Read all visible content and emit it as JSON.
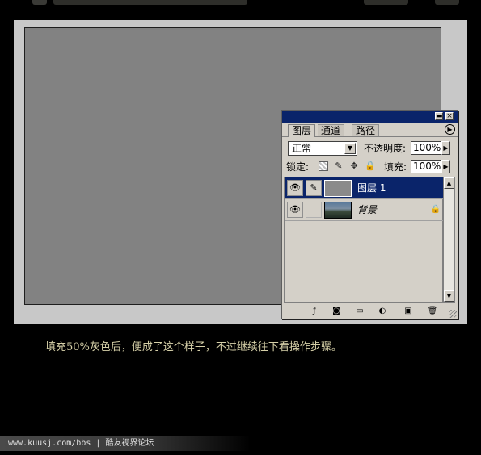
{
  "panel": {
    "tabs": [
      "图层",
      "通道",
      "路径"
    ],
    "blend_mode": "正常",
    "opacity_label": "不透明度:",
    "opacity_value": "100%",
    "lock_label": "锁定:",
    "fill_label": "填充:",
    "fill_value": "100%",
    "layers": [
      {
        "name": "图层 1",
        "selected": true
      },
      {
        "name": "背景",
        "selected": false,
        "locked": true
      }
    ],
    "bottom_icons": [
      "layer-style-icon",
      "layer-mask-icon",
      "new-set-icon",
      "adjustment-layer-icon",
      "new-layer-icon",
      "trash-icon"
    ]
  },
  "caption": "填充50%灰色后，便成了这个样子，不过继续往下看操作步骤。",
  "footer": "www.kuusj.com/bbs | 酷友视界论坛",
  "colors": {
    "canvas_gray": "#828282",
    "selection_blue": "#0a246a",
    "caption_text": "#d6d0a8"
  }
}
